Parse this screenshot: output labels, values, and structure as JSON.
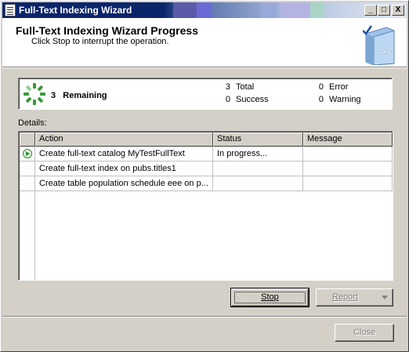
{
  "window": {
    "title": "Full-Text Indexing Wizard",
    "controls": {
      "minimize": "_",
      "maximize": "□",
      "close": "X"
    }
  },
  "header": {
    "title": "Full-Text Indexing Wizard Progress",
    "subtitle": "Click Stop to interrupt the operation.",
    "book_letters": "AZ"
  },
  "summary": {
    "remaining_count": "3",
    "remaining_label": "Remaining",
    "total_count": "3",
    "total_label": "Total",
    "success_count": "0",
    "success_label": "Success",
    "error_count": "0",
    "error_label": "Error",
    "warning_count": "0",
    "warning_label": "Warning"
  },
  "details": {
    "label": "Details:",
    "columns": [
      "Action",
      "Status",
      "Message"
    ],
    "rows": [
      {
        "action": "Create full-text catalog MyTestFullText",
        "status": "In progress...",
        "message": "",
        "icon": "in-progress-icon"
      },
      {
        "action": "Create full-text index on pubs.titles1",
        "status": "",
        "message": ""
      },
      {
        "action": "Create table population schedule eee on p...",
        "status": "",
        "message": ""
      }
    ]
  },
  "buttons": {
    "stop": "Stop",
    "report": "Report",
    "close": "Close"
  },
  "colors": {
    "titlebar": "#0a246a",
    "spinner": "#3a9a3a",
    "face": "#d4d0c8"
  }
}
